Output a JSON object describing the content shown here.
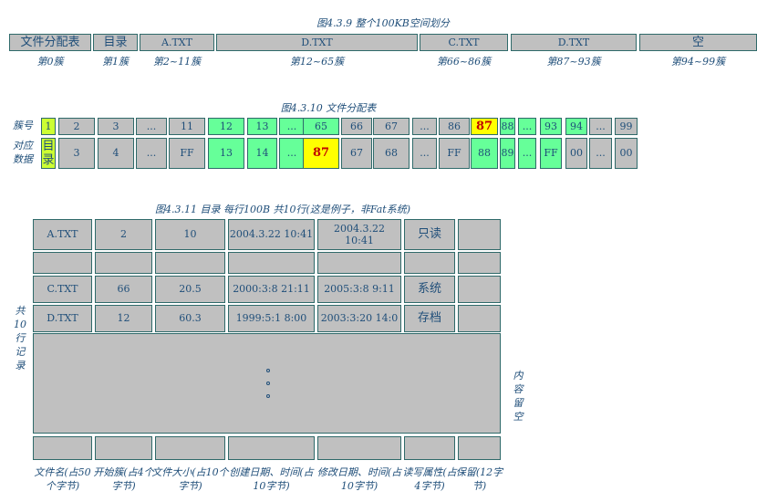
{
  "fig1": {
    "title": "图4.3.9 整个100KB空间划分",
    "segments": [
      {
        "label": "文件分配表",
        "sub": "第0簇"
      },
      {
        "label": "目录",
        "sub": "第1簇"
      },
      {
        "label": "A.TXT",
        "sub": "第2~11簇"
      },
      {
        "label": "D.TXT",
        "sub": "第12~65簇"
      },
      {
        "label": "C.TXT",
        "sub": "第66~86簇"
      },
      {
        "label": "D.TXT",
        "sub": "第87~93簇"
      },
      {
        "label": "空",
        "sub": "第94~99簇"
      }
    ]
  },
  "fig2": {
    "title": "图4.3.10 文件分配表",
    "row1_label": "簇号",
    "row2_label": "对应数据",
    "row1": [
      "1",
      "2",
      "3",
      "...",
      "11",
      "12",
      "13",
      "...",
      "65",
      "66",
      "67",
      "...",
      "86",
      "87",
      "88",
      "...",
      "93",
      "94",
      "...",
      "99"
    ],
    "row2": [
      "目录",
      "3",
      "4",
      "...",
      "FF",
      "13",
      "14",
      "...",
      "87",
      "67",
      "68",
      "...",
      "FF",
      "88",
      "89",
      "...",
      "FF",
      "00",
      "...",
      "00"
    ]
  },
  "fig3": {
    "title": "图4.3.11  目录 每行100B 共10行(这是例子，非Fat系统)",
    "rows": [
      [
        "A.TXT",
        "2",
        "10",
        "2004.3.22 10:41",
        "2004.3.22 10:41",
        "只读",
        ""
      ],
      [
        "",
        "",
        "",
        "",
        "",
        "",
        ""
      ],
      [
        "C.TXT",
        "66",
        "20.5",
        "2000:3:8 21:11",
        "2005:3:8 9:11",
        "系统",
        ""
      ],
      [
        "D.TXT",
        "12",
        "60.3",
        "1999:5:1 8:00",
        "2003:3:20 14:0",
        "存档",
        ""
      ]
    ],
    "left_label": "共10行记录",
    "right_label": "内容留空",
    "footers": [
      "文件名(占50个字节)",
      "开始簇(占4个字节)",
      "文件大小(占10个字节)",
      "创建日期、时间(占10字节)",
      "修改日期、时间(占10字节)",
      "读写属性(占4字节)",
      "保留(12字节)"
    ]
  }
}
